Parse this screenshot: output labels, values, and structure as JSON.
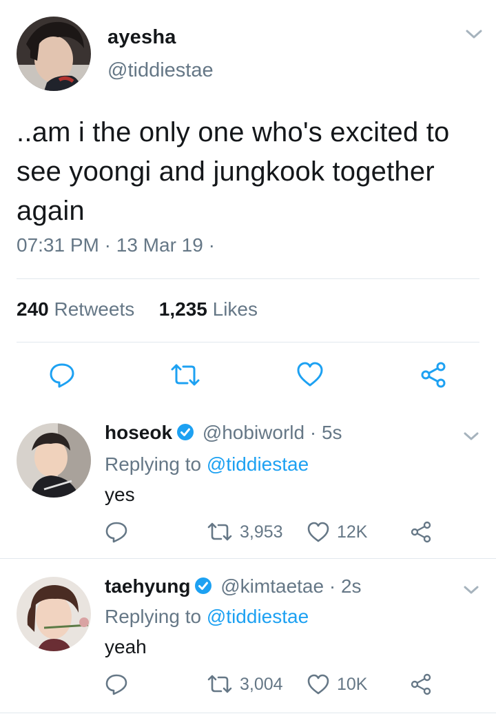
{
  "main_tweet": {
    "display_name": "ayesha",
    "handle": "@tiddiestae",
    "text": "..am i the only one who's excited to see yoongi and jungkook together again",
    "time": "07:31 PM",
    "date": "13 Mar 19",
    "meta_sep": "·",
    "retweets_count": "240",
    "retweets_label": "Retweets",
    "likes_count": "1,235",
    "likes_label": "Likes"
  },
  "replies": [
    {
      "display_name": "hoseok",
      "handle": "@hobiworld",
      "time": "· 5s",
      "replying_prefix": "Replying to",
      "replying_handle": "@tiddiestae",
      "text": "yes",
      "retweets": "3,953",
      "likes": "12K"
    },
    {
      "display_name": "taehyung",
      "handle": "@kimtaetae",
      "time": "· 2s",
      "replying_prefix": "Replying to",
      "replying_handle": "@tiddiestae",
      "text": "yeah",
      "retweets": "3,004",
      "likes": "10K"
    }
  ],
  "colors": {
    "text": "#14171a",
    "muted": "#657786",
    "link": "#1da1f2",
    "divider": "#e1e8ed",
    "verified": "#1da1f2"
  },
  "icons": [
    "chevron-down-icon",
    "reply-icon",
    "retweet-icon",
    "like-icon",
    "share-icon",
    "verified-badge-icon"
  ]
}
